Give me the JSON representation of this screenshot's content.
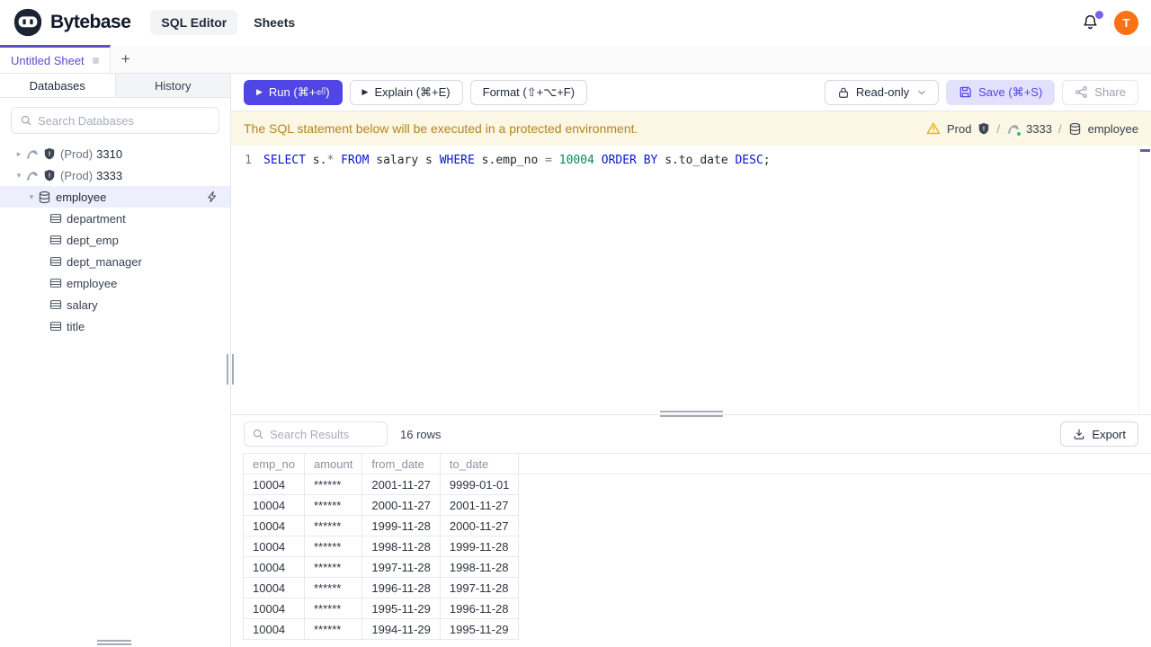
{
  "header": {
    "brand": "Bytebase",
    "nav": [
      {
        "label": "SQL Editor",
        "active": true
      },
      {
        "label": "Sheets",
        "active": false
      }
    ],
    "avatar_initial": "T"
  },
  "sheetbar": {
    "active_tab": "Untitled Sheet",
    "add_tab": "+"
  },
  "sidebar": {
    "tabs": [
      {
        "label": "Databases",
        "active": true
      },
      {
        "label": "History",
        "active": false
      }
    ],
    "search_placeholder": "Search Databases",
    "tree": {
      "instances": [
        {
          "env": "(Prod)",
          "name": "3310",
          "expanded": false
        },
        {
          "env": "(Prod)",
          "name": "3333",
          "expanded": true
        }
      ],
      "database": {
        "label": "employee",
        "selected": true
      },
      "tables": [
        "department",
        "dept_emp",
        "dept_manager",
        "employee",
        "salary",
        "title"
      ]
    }
  },
  "toolbar": {
    "run_label": "Run (⌘+⏎)",
    "explain_label": "Explain (⌘+E)",
    "format_label": "Format (⇧+⌥+F)",
    "readonly_label": "Read-only",
    "save_label": "Save (⌘+S)",
    "share_label": "Share"
  },
  "banner": {
    "message": "The SQL statement below will be executed in a protected environment.",
    "environment": "Prod",
    "separator": "/",
    "instance": "3333",
    "database": "employee"
  },
  "editor": {
    "line_number": "1",
    "sql_text": "SELECT s.* FROM salary s WHERE s.emp_no = 10004 ORDER BY s.to_date DESC;",
    "tokens": [
      {
        "text": "SELECT",
        "type": "kw"
      },
      {
        "text": " s.",
        "type": "plain"
      },
      {
        "text": "*",
        "type": "op"
      },
      {
        "text": " ",
        "type": "plain"
      },
      {
        "text": "FROM",
        "type": "kw"
      },
      {
        "text": " salary s ",
        "type": "plain"
      },
      {
        "text": "WHERE",
        "type": "kw"
      },
      {
        "text": " s.emp_no ",
        "type": "plain"
      },
      {
        "text": "=",
        "type": "op"
      },
      {
        "text": " ",
        "type": "plain"
      },
      {
        "text": "10004",
        "type": "num"
      },
      {
        "text": " ",
        "type": "plain"
      },
      {
        "text": "ORDER",
        "type": "kw"
      },
      {
        "text": " ",
        "type": "plain"
      },
      {
        "text": "BY",
        "type": "kw"
      },
      {
        "text": " s.to_date ",
        "type": "plain"
      },
      {
        "text": "DESC",
        "type": "kw"
      },
      {
        "text": ";",
        "type": "plain"
      }
    ]
  },
  "results": {
    "search_placeholder": "Search Results",
    "row_count": "16 rows",
    "export_label": "Export",
    "columns": [
      "emp_no",
      "amount",
      "from_date",
      "to_date"
    ],
    "rows": [
      [
        "10004",
        "******",
        "2001-11-27",
        "9999-01-01"
      ],
      [
        "10004",
        "******",
        "2000-11-27",
        "2001-11-27"
      ],
      [
        "10004",
        "******",
        "1999-11-28",
        "2000-11-27"
      ],
      [
        "10004",
        "******",
        "1998-11-28",
        "1999-11-28"
      ],
      [
        "10004",
        "******",
        "1997-11-28",
        "1998-11-28"
      ],
      [
        "10004",
        "******",
        "1996-11-28",
        "1997-11-28"
      ],
      [
        "10004",
        "******",
        "1995-11-29",
        "1996-11-28"
      ],
      [
        "10004",
        "******",
        "1994-11-29",
        "1995-11-29"
      ]
    ]
  },
  "colors": {
    "accent": "#4f46e5",
    "tab_accent": "#5b50c9",
    "warning_bg": "#fbf7e4",
    "warning_text": "#b3861e",
    "warning_icon": "#eab308",
    "avatar_bg": "#f97316",
    "notification_dot": "#7c5ff0",
    "selected_row_bg": "#edeffc",
    "status_dot_green": "#22c55e",
    "sql_keyword": "#0718cf",
    "sql_number": "#098658"
  }
}
